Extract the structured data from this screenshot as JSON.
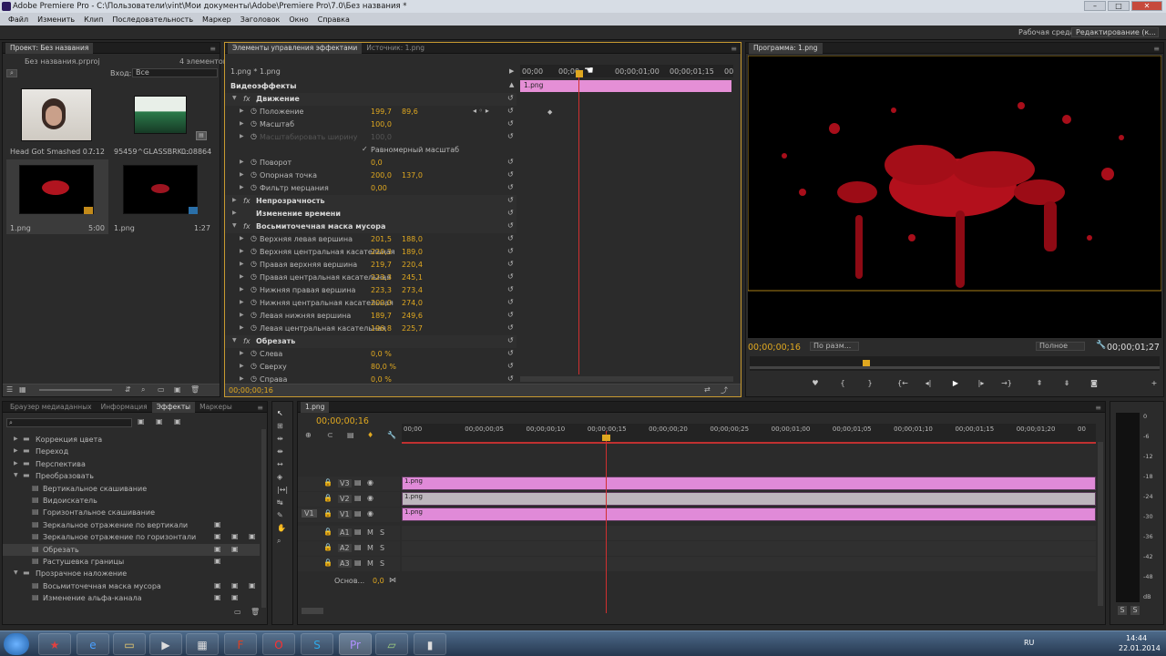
{
  "window": {
    "title": "Adobe Premiere Pro - C:\\Пользователи\\vint\\Мои документы\\Adobe\\Premiere Pro\\7.0\\Без названия *",
    "min": "–",
    "max": "□",
    "close": "✕"
  },
  "menu": [
    "Файл",
    "Изменить",
    "Клип",
    "Последовательность",
    "Маркер",
    "Заголовок",
    "Окно",
    "Справка"
  ],
  "workspace": {
    "label": "Рабочая среда:",
    "value": "Редактирование (к..."
  },
  "project": {
    "tab": "Проект: Без названия",
    "file": "Без названия.prproj",
    "count": "4 элементов",
    "search_icon": "magnifier-icon",
    "in_label": "Вход:",
    "in_value": "Все",
    "items": [
      {
        "name": "Head Got Smashed 0...",
        "dur": "7:12"
      },
      {
        "name": "95459^GLASSBRK...",
        "dur": "0:08864"
      },
      {
        "name": "1.png",
        "dur": "5:00"
      },
      {
        "name": "1.png",
        "dur": "1:27"
      }
    ]
  },
  "effect_controls": {
    "tabs": [
      "Элементы управления эффектами",
      "Источник: 1.png"
    ],
    "clip": "1.png * 1.png",
    "video_effects": "Видеоэффекты",
    "ruler": [
      "00;00",
      "00;00",
      "00;00;01;00",
      "00;00;01;15",
      "00"
    ],
    "clip_bar": "1.png",
    "time": "00;00;00;16",
    "rows": [
      {
        "label": "Движение",
        "v1": "",
        "v2": "",
        "kind": "fx"
      },
      {
        "label": "Положение",
        "v1": "199,7",
        "v2": "89,6",
        "kind": "prop"
      },
      {
        "label": "Масштаб",
        "v1": "100,0",
        "v2": "",
        "kind": "prop"
      },
      {
        "label": "Масштабировать ширину",
        "v1": "100,0",
        "v2": "",
        "kind": "dim"
      },
      {
        "label": "Равномерный масштаб",
        "v1": "",
        "v2": "",
        "kind": "check"
      },
      {
        "label": "Поворот",
        "v1": "0,0",
        "v2": "",
        "kind": "prop"
      },
      {
        "label": "Опорная точка",
        "v1": "200,0",
        "v2": "137,0",
        "kind": "prop"
      },
      {
        "label": "Фильтр мерцания",
        "v1": "0,00",
        "v2": "",
        "kind": "prop"
      },
      {
        "label": "Непрозрачность",
        "v1": "",
        "v2": "",
        "kind": "fx"
      },
      {
        "label": "Изменение времени",
        "v1": "",
        "v2": "",
        "kind": "fx2"
      },
      {
        "label": "Восьмиточечная маска мусора",
        "v1": "",
        "v2": "",
        "kind": "fx"
      },
      {
        "label": "Верхняя левая вершина",
        "v1": "201,5",
        "v2": "188,0",
        "kind": "prop"
      },
      {
        "label": "Верхняя центральная касательная",
        "v1": "220,3",
        "v2": "189,0",
        "kind": "prop"
      },
      {
        "label": "Правая верхняя вершина",
        "v1": "219,7",
        "v2": "220,4",
        "kind": "prop"
      },
      {
        "label": "Правая центральная касательная",
        "v1": "223,3",
        "v2": "245,1",
        "kind": "prop"
      },
      {
        "label": "Нижняя правая вершина",
        "v1": "223,3",
        "v2": "273,4",
        "kind": "prop"
      },
      {
        "label": "Нижняя центральная касательная",
        "v1": "200,0",
        "v2": "274,0",
        "kind": "prop"
      },
      {
        "label": "Левая нижняя вершина",
        "v1": "189,7",
        "v2": "249,6",
        "kind": "prop"
      },
      {
        "label": "Левая центральная касательная",
        "v1": "196,8",
        "v2": "225,7",
        "kind": "prop"
      },
      {
        "label": "Обрезать",
        "v1": "",
        "v2": "",
        "kind": "fx"
      },
      {
        "label": "Слева",
        "v1": "0,0 %",
        "v2": "",
        "kind": "prop"
      },
      {
        "label": "Сверху",
        "v1": "80,0 %",
        "v2": "",
        "kind": "prop"
      },
      {
        "label": "Справа",
        "v1": "0,0 %",
        "v2": "",
        "kind": "prop"
      }
    ]
  },
  "program": {
    "tab": "Программа: 1.png",
    "timecode": "00;00;00;16",
    "fit": "По разм...",
    "quality": "Полное",
    "duration": "00;00;01;27"
  },
  "effects": {
    "tabs": [
      "Браузер медиаданных",
      "Информация",
      "Эффекты",
      "Маркеры"
    ],
    "tree": [
      {
        "label": "Коррекция цвета",
        "level": 1,
        "folder": true
      },
      {
        "label": "Переход",
        "level": 1,
        "folder": true
      },
      {
        "label": "Перспектива",
        "level": 1,
        "folder": true
      },
      {
        "label": "Преобразовать",
        "level": 1,
        "folder": true,
        "open": true
      },
      {
        "label": "Вертикальное скашивание",
        "level": 2
      },
      {
        "label": "Видоискатель",
        "level": 2
      },
      {
        "label": "Горизонтальное скашивание",
        "level": 2
      },
      {
        "label": "Зеркальное отражение по вертикали",
        "level": 2,
        "b": 1
      },
      {
        "label": "Зеркальное отражение по горизонтали",
        "level": 2,
        "b": 3
      },
      {
        "label": "Обрезать",
        "level": 2,
        "b": 2,
        "sel": true
      },
      {
        "label": "Растушевка границы",
        "level": 2,
        "b": 1
      },
      {
        "label": "Прозрачное наложение",
        "level": 1,
        "folder": true,
        "open": true
      },
      {
        "label": "Восьмиточечная маска мусора",
        "level": 2,
        "b": 3
      },
      {
        "label": "Изменение альфа-канала",
        "level": 2,
        "b": 2
      }
    ]
  },
  "timeline": {
    "tab": "1.png",
    "timecode": "00;00;00;16",
    "ruler": [
      "00;00",
      "00;00;00;05",
      "00;00;00;10",
      "00;00;00;15",
      "00;00;00;20",
      "00;00;00;25",
      "00;00;01;00",
      "00;00;01;05",
      "00;00;01;10",
      "00;00;01;15",
      "00;00;01;20",
      "00"
    ],
    "tracks": [
      {
        "name": "V3",
        "clip": "1.png"
      },
      {
        "name": "V2",
        "clip": "1.png"
      },
      {
        "name": "V1",
        "clip": "1.png",
        "target": "V1"
      },
      {
        "name": "A1",
        "m": "M",
        "s": "S"
      },
      {
        "name": "A2",
        "m": "M",
        "s": "S"
      },
      {
        "name": "A3",
        "m": "M",
        "s": "S"
      }
    ],
    "master_label": "Основ...",
    "master_value": "0,0"
  },
  "meter": {
    "labels": [
      "0",
      "-6",
      "-12",
      "-18",
      "-24",
      "-30",
      "-36",
      "-42",
      "-48",
      "dB"
    ],
    "solo": "S"
  },
  "taskbar": {
    "lang": "RU",
    "time": "14:44",
    "date": "22.01.2014"
  }
}
